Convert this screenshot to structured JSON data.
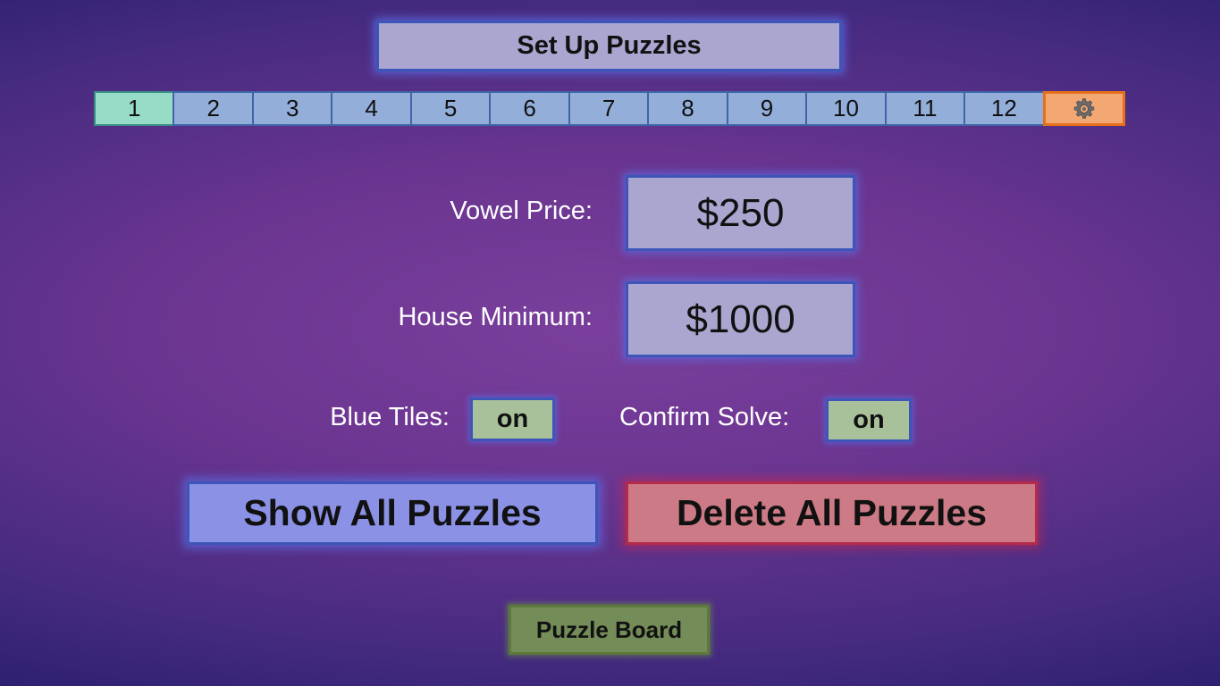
{
  "header": {
    "title": "Set Up Puzzles"
  },
  "tabs": [
    {
      "label": "1",
      "active": true
    },
    {
      "label": "2"
    },
    {
      "label": "3"
    },
    {
      "label": "4"
    },
    {
      "label": "5"
    },
    {
      "label": "6"
    },
    {
      "label": "7"
    },
    {
      "label": "8"
    },
    {
      "label": "9"
    },
    {
      "label": "10"
    },
    {
      "label": "11"
    },
    {
      "label": "12"
    }
  ],
  "settings_tab": {
    "icon": "gear-icon",
    "active": true
  },
  "settings": {
    "vowel_price": {
      "label": "Vowel Price:",
      "value": "$250"
    },
    "house_minimum": {
      "label": "House Minimum:",
      "value": "$1000"
    },
    "blue_tiles": {
      "label": "Blue Tiles:",
      "value": "on"
    },
    "confirm_solve": {
      "label": "Confirm Solve:",
      "value": "on"
    }
  },
  "actions": {
    "show_all": "Show All Puzzles",
    "delete_all": "Delete All Puzzles",
    "puzzle_board": "Puzzle Board"
  },
  "colors": {
    "tab": "#93aed9",
    "tab_active": "#97dcc6",
    "settings_tab": "#f3a874",
    "value_box": "#aaa6d0",
    "toggle_on": "#a9c19b",
    "show_button": "#8b92e6",
    "delete_button": "#cc7b86",
    "board_button": "#748c58"
  }
}
